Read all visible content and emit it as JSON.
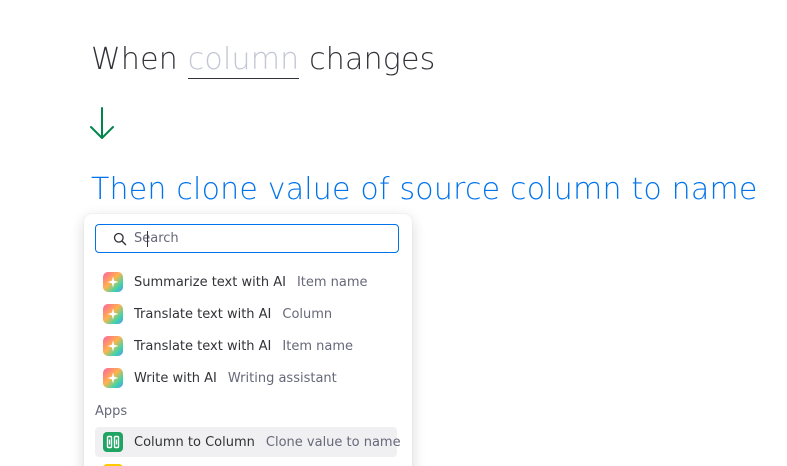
{
  "trigger": {
    "prefix": "When",
    "placeholder": "column",
    "suffix": "changes"
  },
  "action": {
    "sentence": "Then clone value of source column to name"
  },
  "dropdown": {
    "search": {
      "placeholder": "Search",
      "value": ""
    },
    "ai_items": [
      {
        "title": "Summarize text with AI",
        "subtitle": "Item name",
        "icon": "ai-sparkle-icon"
      },
      {
        "title": "Translate text with AI",
        "subtitle": "Column",
        "icon": "ai-sparkle-icon"
      },
      {
        "title": "Translate text with AI",
        "subtitle": "Item name",
        "icon": "ai-sparkle-icon"
      },
      {
        "title": "Write with AI",
        "subtitle": "Writing assistant",
        "icon": "ai-sparkle-icon"
      }
    ],
    "apps_section_label": "Apps",
    "app_items": [
      {
        "title": "Column to Column",
        "subtitle": "Clone value to name",
        "icon": "column-to-column-app-icon"
      }
    ]
  },
  "colors": {
    "accent": "#0073ea",
    "trigger_text": "#323338",
    "placeholder": "#c3c6d4",
    "arrow": "#00854d",
    "app_icon": "#1fa463"
  }
}
